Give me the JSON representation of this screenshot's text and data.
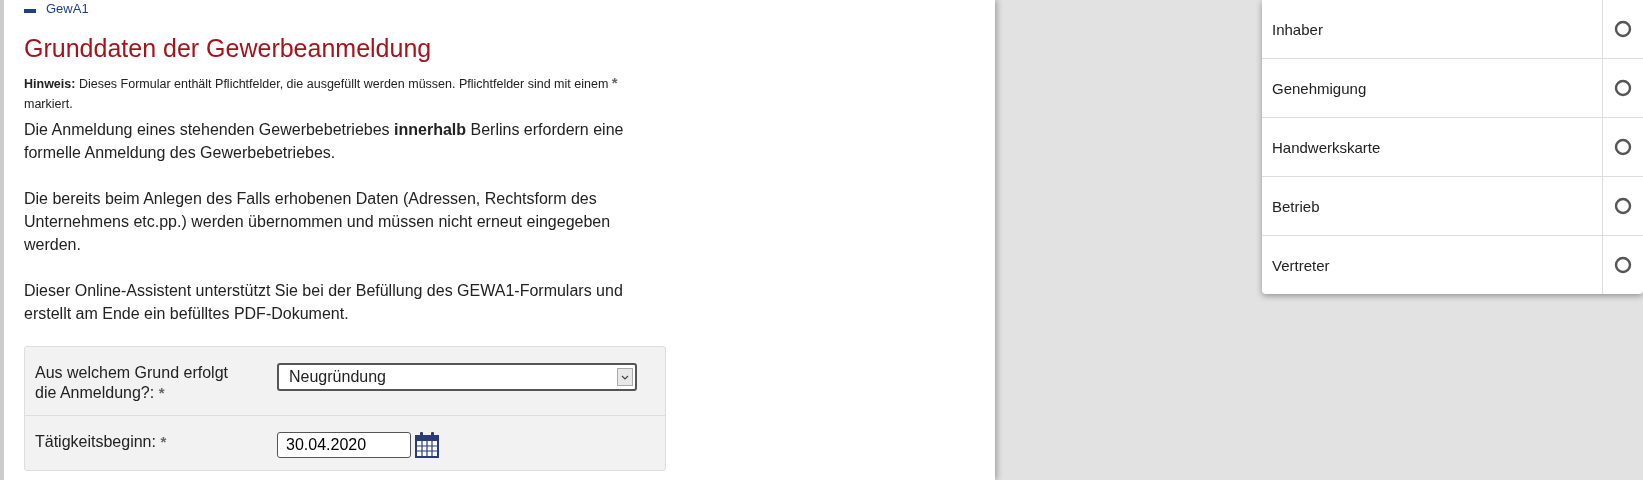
{
  "breadcrumb": {
    "label": "GewA1"
  },
  "heading": "Grunddaten der Gewerbeanmeldung",
  "notice": {
    "label": "Hinweis:",
    "text": "Dieses Formular enthält Pflichtfelder, die ausgefüllt werden müssen. Pflichtfelder sind mit einem",
    "marker": "*",
    "text_after": "markiert."
  },
  "paragraphs": [
    "Die Anmeldung eines stehenden Gewerbebetriebes **innerhalb** Berlins erfordern eine formelle Anmeldung des Gewerbebetriebes.",
    "Die bereits beim Anlegen des Falls erhobenen Daten (Adressen, Rechtsform des Unternehmens etc.pp.) werden übernommen und müssen nicht erneut eingegeben werden.",
    "Dieser Online-Assistent unterstützt Sie bei der Befüllung des GEWA1-Formulars und erstellt am Ende ein befülltes PDF-Dokument."
  ],
  "form": [
    {
      "kind": "select",
      "label": "Aus welchem Grund erfolgt die Anmeldung?:",
      "required": true,
      "value": "Neugründung"
    },
    {
      "kind": "date",
      "label": "Tätigkeitsbeginn:",
      "required": true,
      "value": "30.04.2020"
    }
  ],
  "steps": [
    {
      "label": "Inhaber",
      "done": false
    },
    {
      "label": "Genehmigung",
      "done": false
    },
    {
      "label": "Handwerkskarte",
      "done": false
    },
    {
      "label": "Betrieb",
      "done": false
    },
    {
      "label": "Vertreter",
      "done": false
    }
  ]
}
